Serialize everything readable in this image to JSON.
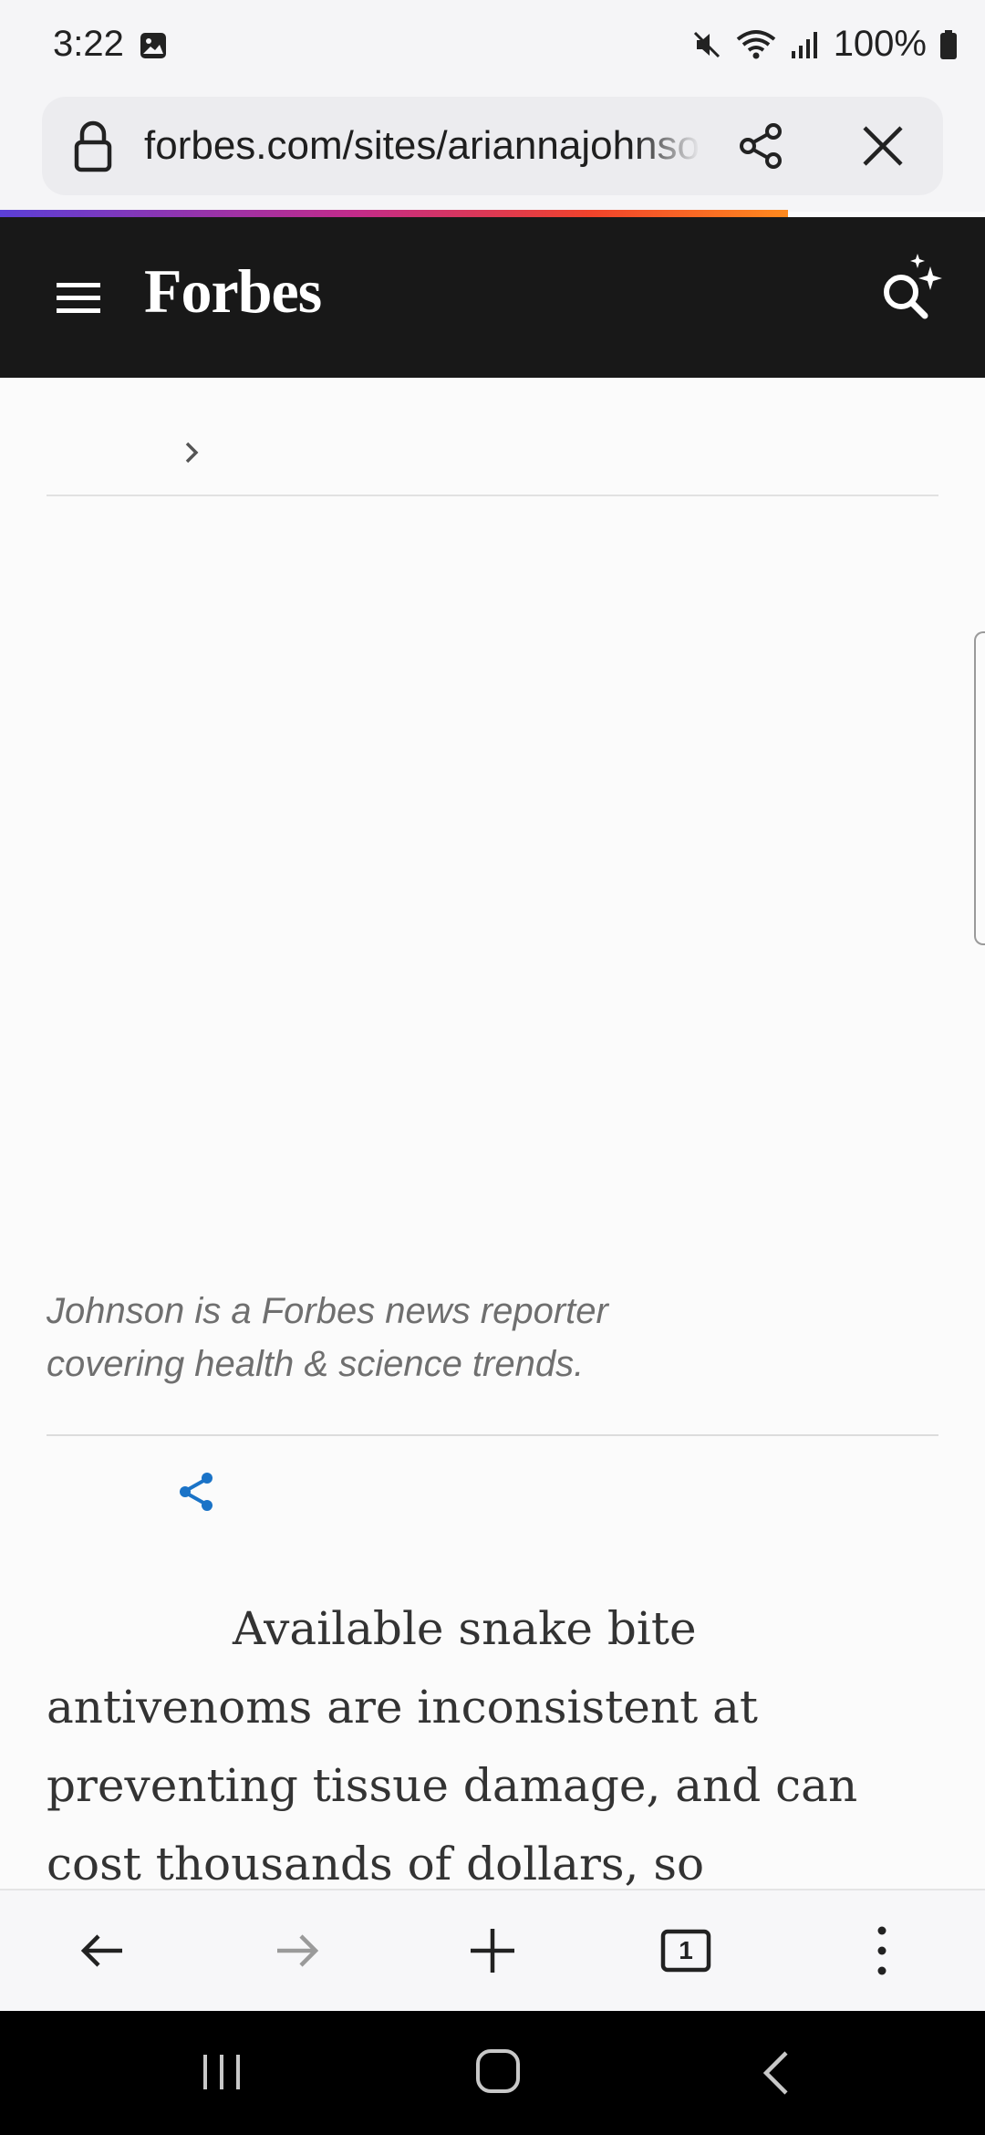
{
  "status_bar": {
    "time": "3:22",
    "battery": "100%",
    "icons": [
      "image-notification-icon",
      "mute-icon",
      "wifi-icon",
      "signal-icon",
      "battery-icon"
    ]
  },
  "browser": {
    "url": "forbes.com/sites/ariannajohnson",
    "tab_count": "1",
    "progress_fraction": 0.8
  },
  "site": {
    "logo": "Forbes",
    "header_bg": "#181818"
  },
  "author": {
    "bio": "Johnson is a Forbes news reporter covering health & science trends."
  },
  "article": {
    "lead": "Available snake bite antivenoms are inconsistent at preventing tissue damage, and can cost thousands of dollars, so"
  },
  "colors": {
    "share_accent": "#1a73c7",
    "text": "#333333",
    "bio_text": "#6f6f6f"
  }
}
